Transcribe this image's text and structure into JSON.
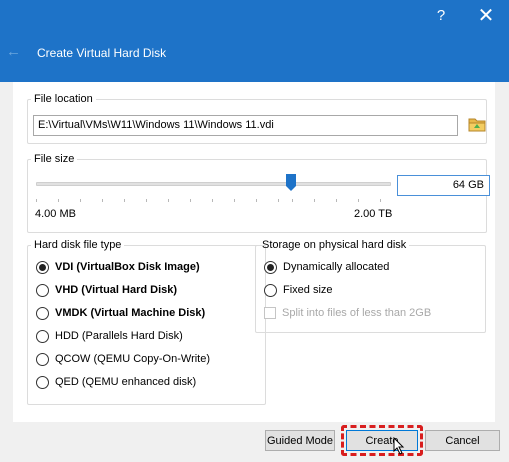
{
  "window": {
    "help_glyph": "?",
    "close_glyph": "✕",
    "back_glyph": "←",
    "title": "Create Virtual Hard Disk"
  },
  "file_location": {
    "legend": "File location",
    "value": "E:\\Virtual\\VMs\\W11\\Windows 11\\Windows 11.vdi"
  },
  "file_size": {
    "legend": "File size",
    "min_label": "4.00 MB",
    "max_label": "2.00 TB",
    "value": "64 GB"
  },
  "disk_type": {
    "legend": "Hard disk file type",
    "options": [
      {
        "label": "VDI (VirtualBox Disk Image)",
        "selected": true
      },
      {
        "label": "VHD (Virtual Hard Disk)",
        "selected": false
      },
      {
        "label": "VMDK (Virtual Machine Disk)",
        "selected": false
      },
      {
        "label": "HDD (Parallels Hard Disk)",
        "selected": false
      },
      {
        "label": "QCOW (QEMU Copy-On-Write)",
        "selected": false
      },
      {
        "label": "QED (QEMU enhanced disk)",
        "selected": false
      }
    ]
  },
  "storage": {
    "legend": "Storage on physical hard disk",
    "dynamic": "Dynamically allocated",
    "fixed": "Fixed size",
    "split": "Split into files of less than 2GB"
  },
  "buttons": {
    "guided": "Guided Mode",
    "create": "Create",
    "cancel": "Cancel"
  },
  "colors": {
    "titlebar": "#1e73c8",
    "highlight": "#d81e1e",
    "focus": "#0078d7"
  }
}
